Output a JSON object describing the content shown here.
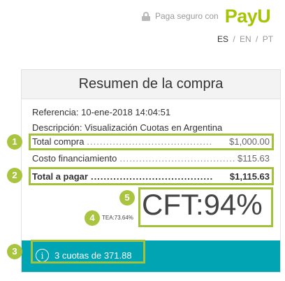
{
  "header": {
    "secure_text": "Paga seguro con",
    "logo_text": "PayU",
    "brand_color": "#a6c307"
  },
  "languages": [
    "ES",
    "EN",
    "PT"
  ],
  "active_language": "ES",
  "card": {
    "title": "Resumen de la compra",
    "reference_label": "Referencia:",
    "reference_value": "10-ene-2018 14:04:51",
    "description_label": "Descripción:",
    "description_value": "Visualización Cuotas en Argentina",
    "total_compra_label": "Total compra",
    "total_compra_dots": ".......................................",
    "total_compra_value": "$1,000.00",
    "costo_label": "Costo financiamiento",
    "costo_dots": "....................................",
    "costo_value": "$115.63",
    "total_pagar_label": "Total a pagar",
    "total_pagar_dots": "......................................",
    "total_pagar_value": "$1,115.63",
    "cft_text": "CFT:94%",
    "tea_text": "TEA:73.64%",
    "cuotas_text": "3 cuotas de 371.88",
    "bar_color": "#00a4b2"
  },
  "annotations": {
    "badges": [
      "1",
      "2",
      "3",
      "4",
      "5"
    ],
    "highlight_color": "#a2c23c"
  }
}
